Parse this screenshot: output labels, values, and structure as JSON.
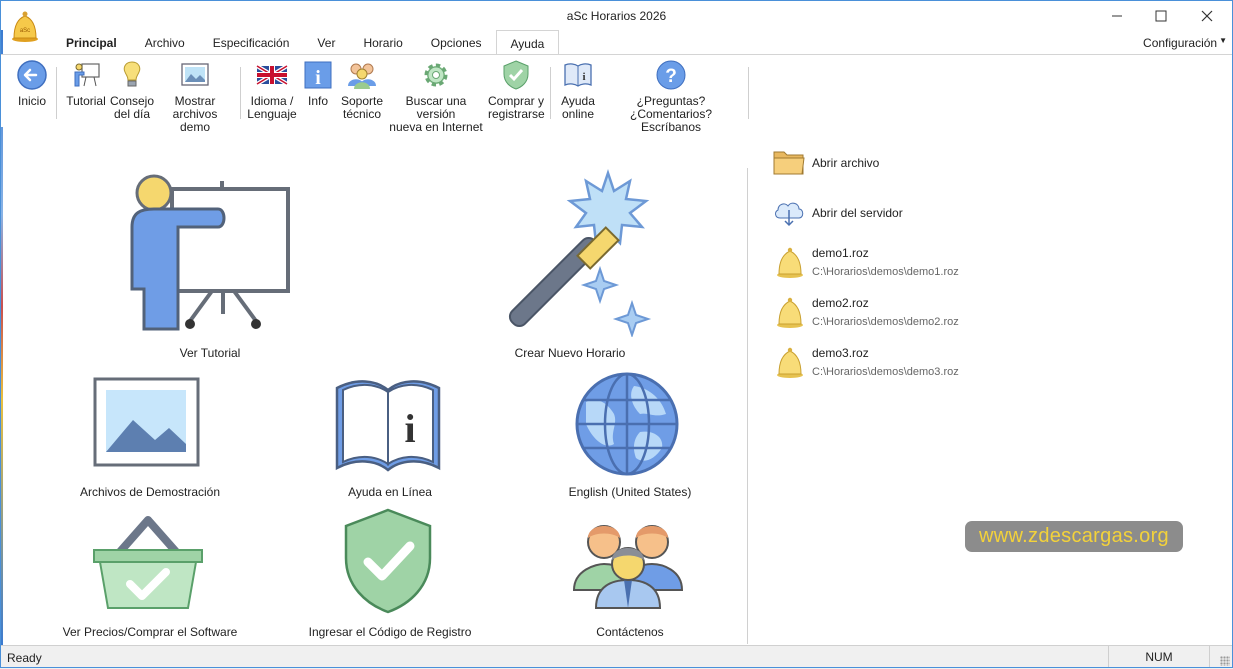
{
  "window": {
    "title": "aSc Horarios 2026"
  },
  "tabs": [
    "Principal",
    "Archivo",
    "Especificación",
    "Ver",
    "Horario",
    "Opciones",
    "Ayuda"
  ],
  "config_label": "Configuración",
  "ribbon": {
    "inicio": "Inicio",
    "tutorial": "Tutorial",
    "consejo_1": "Consejo",
    "consejo_2": "del día",
    "mostrar_1": "Mostrar",
    "mostrar_2": "archivos demo",
    "idioma_1": "Idioma /",
    "idioma_2": "Lenguaje",
    "info": "Info",
    "soporte_1": "Soporte",
    "soporte_2": "técnico",
    "buscar_1": "Buscar una versión",
    "buscar_2": "nueva en Internet",
    "comprar_1": "Comprar y",
    "comprar_2": "registrarse",
    "ayuda_1": "Ayuda",
    "ayuda_2": "online",
    "preguntas_1": "¿Preguntas? ¿Comentarios?",
    "preguntas_2": "Escríbanos"
  },
  "tiles": {
    "tutorial": "Ver Tutorial",
    "nuevo": "Crear Nuevo Horario",
    "demos": "Archivos de Demostración",
    "ayuda": "Ayuda en Línea",
    "idioma": "English (United States)",
    "precios": "Ver Precios/Comprar el Software",
    "registro": "Ingresar el Código de Registro",
    "contacto": "Contáctenos"
  },
  "right_panel": {
    "abrir_archivo": "Abrir archivo",
    "abrir_servidor": "Abrir del servidor",
    "recent": [
      {
        "name": "demo1.roz",
        "path": "C:\\Horarios\\demos\\demo1.roz"
      },
      {
        "name": "demo2.roz",
        "path": "C:\\Horarios\\demos\\demo2.roz"
      },
      {
        "name": "demo3.roz",
        "path": "C:\\Horarios\\demos\\demo3.roz"
      }
    ]
  },
  "watermark": "www.zdescargas.org",
  "status": {
    "text": "Ready",
    "num": "NUM"
  },
  "colors": {
    "accent_blue": "#5b8fe0",
    "bell_yellow": "#f5d76e",
    "green_check": "#7fd18e",
    "frame_border": "#4a90d9"
  }
}
